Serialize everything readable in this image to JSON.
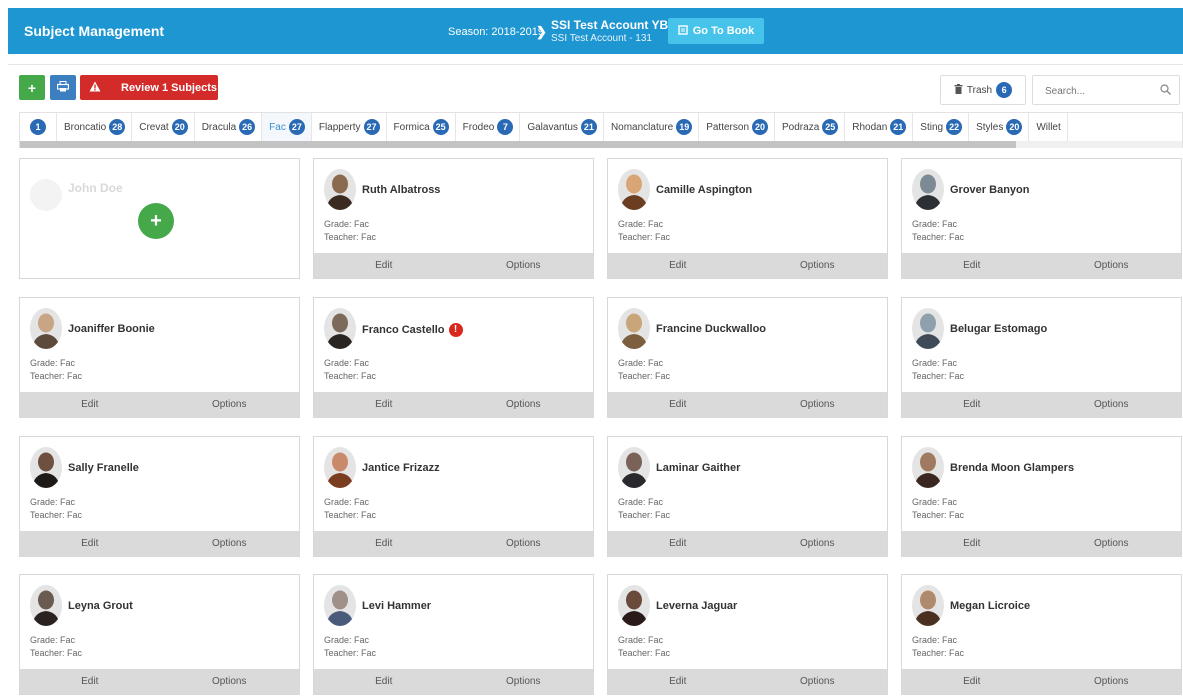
{
  "header": {
    "title": "Subject Management",
    "season": "Season: 2018-2019",
    "account_name": "SSI Test Account YB",
    "account_sub": "SSI Test Account - 131",
    "goto_book": "Go To Book"
  },
  "toolbar": {
    "add_label": "+",
    "review_label": "Review 1 Subjects",
    "trash_label": "Trash",
    "trash_count": "6",
    "search_placeholder": "Search..."
  },
  "tabs": [
    {
      "label": "",
      "count": "1"
    },
    {
      "label": "Broncatio",
      "count": "28"
    },
    {
      "label": "Crevat",
      "count": "20"
    },
    {
      "label": "Dracula",
      "count": "26"
    },
    {
      "label": "Fac",
      "count": "27",
      "active": true
    },
    {
      "label": "Flapperty",
      "count": "27"
    },
    {
      "label": "Formica",
      "count": "25"
    },
    {
      "label": "Frodeo",
      "count": "7"
    },
    {
      "label": "Galavantus",
      "count": "21"
    },
    {
      "label": "Nomanclature",
      "count": "19"
    },
    {
      "label": "Patterson",
      "count": "20"
    },
    {
      "label": "Podraza",
      "count": "25"
    },
    {
      "label": "Rhodan",
      "count": "21"
    },
    {
      "label": "Sting",
      "count": "22"
    },
    {
      "label": "Styles",
      "count": "20"
    },
    {
      "label": "Willet",
      "count": ""
    }
  ],
  "placeholder_card": {
    "name": "John Doe",
    "add_icon": "+"
  },
  "card_labels": {
    "grade": "Grade: Fac",
    "teacher": "Teacher: Fac",
    "edit": "Edit",
    "options": "Options"
  },
  "subjects": [
    {
      "name": "Ruth Albatross"
    },
    {
      "name": "Camille Aspington"
    },
    {
      "name": "Grover Banyon"
    },
    {
      "name": "Joaniffer Boonie"
    },
    {
      "name": "Franco Castello",
      "alert": "!"
    },
    {
      "name": "Francine Duckwalloo"
    },
    {
      "name": "Belugar Estomago"
    },
    {
      "name": "Sally Franelle"
    },
    {
      "name": "Jantice Frizazz"
    },
    {
      "name": "Laminar Gaither"
    },
    {
      "name": "Brenda Moon Glampers"
    },
    {
      "name": "Leyna Grout"
    },
    {
      "name": "Levi Hammer"
    },
    {
      "name": "Leverna Jaguar"
    },
    {
      "name": "Megan Licroice"
    }
  ],
  "colors": {
    "header_bg": "#1e96d2",
    "accent_blue": "#2a6ab5",
    "add_green": "#45a849",
    "review_red": "#d32a2a",
    "goto_light": "#45c3ea"
  }
}
